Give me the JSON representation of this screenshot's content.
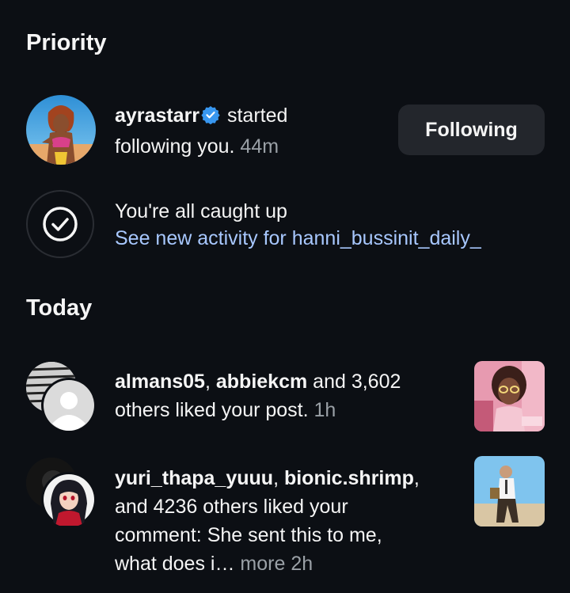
{
  "priority": {
    "section_title": "Priority",
    "notification": {
      "username": "ayrastarr",
      "verified": true,
      "text_1": " started",
      "text_2": "following you.",
      "time": " 44m",
      "button_label": "Following"
    },
    "caught_up": {
      "title": "You're all caught up",
      "link": "See new activity for hanni_bussinit_daily_"
    }
  },
  "today": {
    "section_title": "Today",
    "items": [
      {
        "user_1": "almans05",
        "sep": ", ",
        "user_2": "abbiekcm",
        "text_a": " and 3,602",
        "text_b": "others liked your post.",
        "time": " 1h"
      },
      {
        "user_1": "yuri_thapa_yuuu",
        "sep": ", ",
        "user_2": "bionic.shrimp",
        "comma": ",",
        "line_2": "and 4236 others liked your",
        "line_3": "comment: She sent this to me,",
        "line_4": "what does i…",
        "more": " more",
        "time": " 2h"
      }
    ]
  },
  "colors": {
    "background": "#0c0f14",
    "link": "#a8c8ff",
    "verified": "#3897f0",
    "button_bg": "#23262c"
  }
}
